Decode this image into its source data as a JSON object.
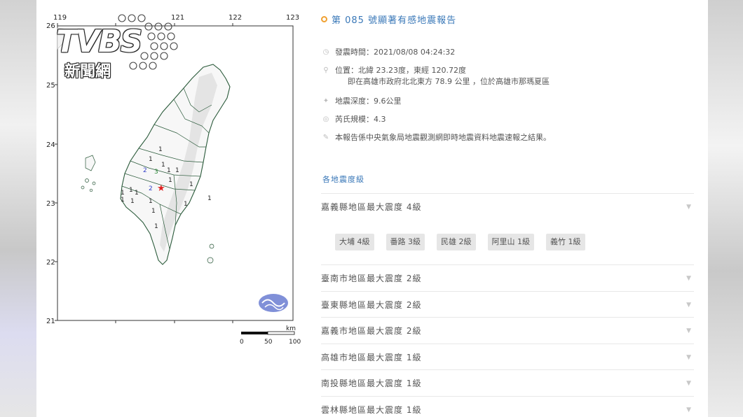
{
  "logo": {
    "brand": "TVBS",
    "sub": "新聞網"
  },
  "map": {
    "lon_ticks": [
      "119",
      "121",
      "122",
      "123"
    ],
    "lat_ticks": [
      "25",
      "24",
      "23",
      "22",
      "21"
    ],
    "lat_top_partial": "26",
    "scale_unit": "km",
    "scale_ticks": [
      "0",
      "50",
      "100"
    ],
    "intensity_labels": [
      {
        "v": "1",
        "c": "#222222"
      },
      {
        "v": "1",
        "c": "#222222"
      },
      {
        "v": "1",
        "c": "#222222"
      },
      {
        "v": "3",
        "c": "#2e8b3a"
      },
      {
        "v": "1",
        "c": "#222222"
      },
      {
        "v": "1",
        "c": "#222222"
      },
      {
        "v": "2",
        "c": "#3340c8"
      },
      {
        "v": "1",
        "c": "#222222"
      },
      {
        "v": "2",
        "c": "#3340c8"
      },
      {
        "v": "1",
        "c": "#222222"
      },
      {
        "v": "1",
        "c": "#222222"
      },
      {
        "v": "1",
        "c": "#222222"
      },
      {
        "v": "1",
        "c": "#222222"
      },
      {
        "v": "1",
        "c": "#222222"
      },
      {
        "v": "1",
        "c": "#222222"
      },
      {
        "v": "1",
        "c": "#222222"
      },
      {
        "v": "1",
        "c": "#222222"
      },
      {
        "v": "1",
        "c": "#222222"
      },
      {
        "v": "1",
        "c": "#222222"
      },
      {
        "v": "1",
        "c": "#222222"
      }
    ],
    "epicenter_color": "#e02020"
  },
  "report": {
    "title": "第 085 號顯著有感地震報告",
    "time": "發震時間：2021/08/08 04:24:32",
    "location_line1": "位置：北緯 23.23度，東經 120.72度",
    "location_line2": "即在高雄市政府北北東方 78.9 公里 ，位於高雄市那瑪夏區",
    "depth": "地震深度：9.6公里",
    "magnitude": "芮氏規模：4.3",
    "note": "本報告係中央氣象局地震觀測網即時地震資料地震速報之結果。",
    "section_title": "各地震度級",
    "regions": [
      "嘉義縣地區最大震度 4級",
      "臺南市地區最大震度 2級",
      "臺東縣地區最大震度 2級",
      "嘉義市地區最大震度 2級",
      "高雄市地區最大震度 1級",
      "南投縣地區最大震度 1級",
      "雲林縣地區最大震度 1級"
    ],
    "chips": [
      "大埔 4級",
      "番路 3級",
      "民雄 2級",
      "阿里山 1級",
      "義竹 1級"
    ]
  }
}
